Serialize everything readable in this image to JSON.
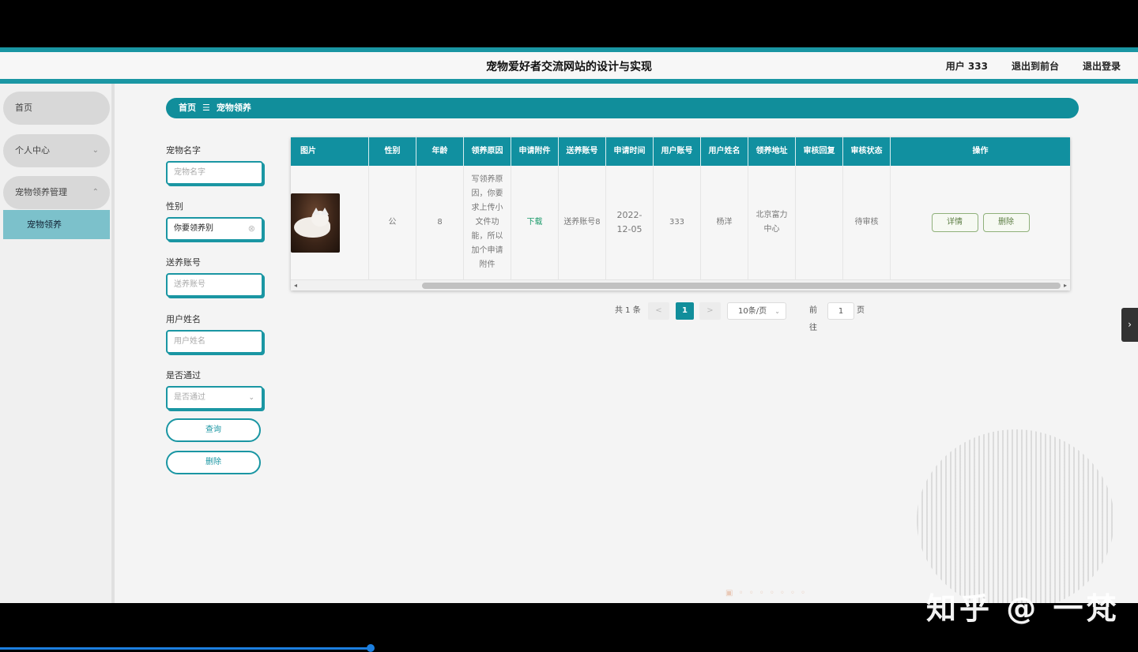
{
  "header": {
    "title": "宠物爱好者交流网站的设计与实现",
    "user_label": "用户 333",
    "to_front": "退出到前台",
    "logout": "退出登录"
  },
  "sidebar": {
    "items": [
      {
        "label": "首页"
      },
      {
        "label": "个人中心",
        "chevron": "chevron-down-icon"
      },
      {
        "label": "宠物领养管理",
        "chevron": "chevron-up-icon"
      }
    ],
    "sub_item": "宠物领养"
  },
  "breadcrumb": {
    "home": "首页",
    "separator": "☰",
    "current": "宠物领养"
  },
  "search": {
    "pet_name_label": "宠物名字",
    "pet_name_placeholder": "宠物名字",
    "gender_label": "性别",
    "gender_value": "你要领养别",
    "sender_label": "送养账号",
    "sender_placeholder": "送养账号",
    "user_name_label": "用户姓名",
    "user_name_placeholder": "用户姓名",
    "approved_label": "是否通过",
    "approved_placeholder": "是否通过",
    "query_button": "查询",
    "delete_button": "删除"
  },
  "table": {
    "headers": [
      "图片",
      "性别",
      "年龄",
      "领养原因",
      "申请附件",
      "送养账号",
      "申请时间",
      "用户账号",
      "用户姓名",
      "领养地址",
      "审核回复",
      "审核状态",
      "操作"
    ],
    "rows": [
      {
        "image": "cat-photo",
        "gender": "公",
        "age": "8",
        "reason": "写领养原因，你要求上传小文件功能，所以加个申请附件",
        "attachment": "下载",
        "sender": "送养账号8",
        "time": "2022-12-05",
        "user_account": "333",
        "user_name": "杨洋",
        "address": "北京富力中心",
        "reply": "",
        "status": "待审核",
        "detail_button": "详情",
        "delete_button": "删除"
      }
    ]
  },
  "pagination": {
    "total": "共 1 条",
    "prev": "<",
    "current": "1",
    "next": ">",
    "page_size": "10条/页",
    "goto_label": "前往",
    "goto_value": "1",
    "page_suffix": "页"
  },
  "watermark": "知乎 @ 一梵",
  "colors": {
    "accent": "#1190a0",
    "sidebar_active": "#7cc1cb"
  }
}
